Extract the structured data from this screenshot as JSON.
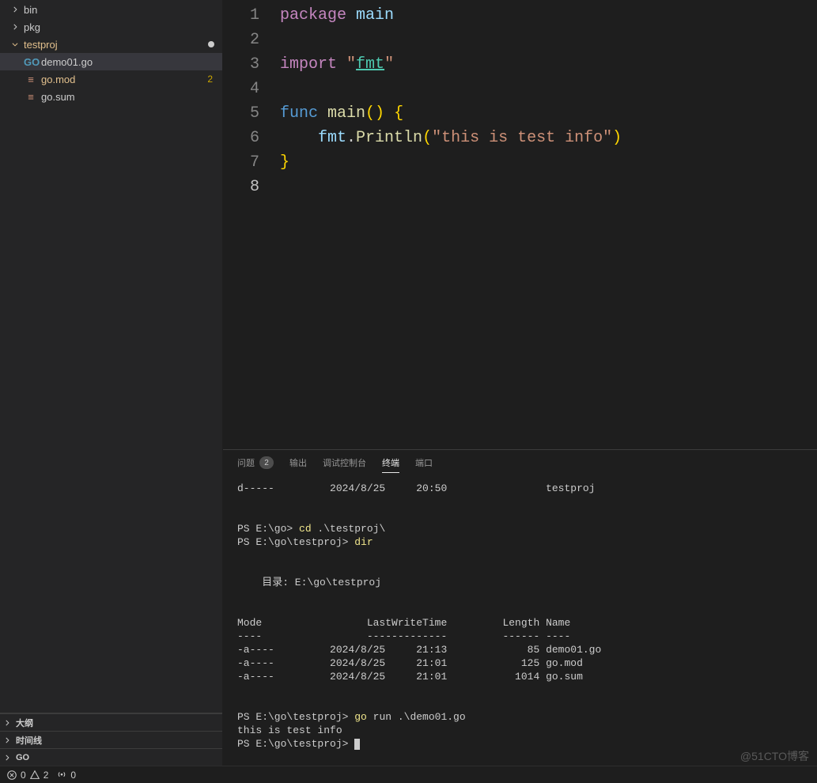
{
  "explorer": {
    "tree": [
      {
        "type": "folder",
        "name": "bin",
        "expanded": false,
        "indent": 1
      },
      {
        "type": "folder",
        "name": "pkg",
        "expanded": false,
        "indent": 1
      },
      {
        "type": "folder",
        "name": "testproj",
        "expanded": true,
        "indent": 1,
        "modified": true,
        "orange": true
      },
      {
        "type": "file",
        "name": "demo01.go",
        "icon": "go",
        "indent": 2,
        "selected": true,
        "orange": false
      },
      {
        "type": "file",
        "name": "go.mod",
        "icon": "mod",
        "indent": 2,
        "orange": true,
        "badge": "2"
      },
      {
        "type": "file",
        "name": "go.sum",
        "icon": "mod",
        "indent": 2
      }
    ],
    "sections": [
      {
        "label": "大纲"
      },
      {
        "label": "时间线"
      },
      {
        "label": "GO"
      }
    ]
  },
  "editor": {
    "lineCount": 8,
    "activeLine": 8,
    "code": {
      "l1": {
        "pkg": "package",
        "name": "main"
      },
      "l3": {
        "imp": "import",
        "q": "\"",
        "mod": "fmt"
      },
      "l5": {
        "func": "func",
        "name": "main",
        "paren": "()",
        "brace": "{"
      },
      "l6": {
        "pkg": "fmt",
        "dot": ".",
        "fn": "Println",
        "open": "(",
        "str": "\"this is test info\"",
        "close": ")"
      },
      "l7": {
        "brace": "}"
      }
    }
  },
  "panel": {
    "tabs": {
      "problems": "问题",
      "problems_count": "2",
      "output": "输出",
      "debug": "调试控制台",
      "terminal": "终端",
      "ports": "端口"
    },
    "terminal": {
      "line1": "d-----         2024/8/25     20:50                testproj",
      "blank": "",
      "line2_prompt": "PS E:\\go> ",
      "line2_cmd": "cd",
      "line2_arg": " .\\testproj\\",
      "line3_prompt": "PS E:\\go\\testproj> ",
      "line3_cmd": "dir",
      "dir_header": "    目录: E:\\go\\testproj",
      "tbl_hdr": "Mode                 LastWriteTime         Length Name",
      "tbl_sep": "----                 -------------         ------ ----",
      "tbl_r1": "-a----         2024/8/25     21:13             85 demo01.go",
      "tbl_r2": "-a----         2024/8/25     21:01            125 go.mod",
      "tbl_r3": "-a----         2024/8/25     21:01           1014 go.sum",
      "run_prompt": "PS E:\\go\\testproj> ",
      "run_cmd": "go",
      "run_arg": " run .\\demo01.go",
      "run_out": "this is test info",
      "final_prompt": "PS E:\\go\\testproj> "
    }
  },
  "statusbar": {
    "errors": "0",
    "warnings": "2",
    "ports": "0"
  },
  "watermark": "@51CTO博客"
}
